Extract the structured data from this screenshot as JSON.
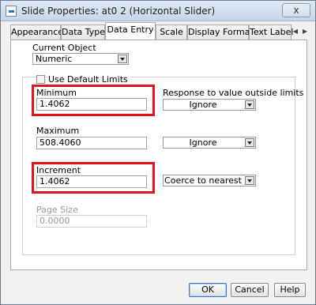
{
  "window": {
    "title": "Slide Properties: at0 2 (Horizontal Slider)",
    "close_label": "x"
  },
  "tabs": [
    {
      "label": "Appearance",
      "active": false
    },
    {
      "label": "Data Type",
      "active": false
    },
    {
      "label": "Data Entry",
      "active": true
    },
    {
      "label": "Scale",
      "active": false
    },
    {
      "label": "Display Format",
      "active": false
    },
    {
      "label": "Text Label",
      "active": false
    }
  ],
  "tab_scroll": {
    "left": "◀",
    "right": "▶"
  },
  "current_object": {
    "label": "Current Object",
    "value": "Numeric"
  },
  "use_default_limits": {
    "label": "Use Default Limits",
    "checked": false
  },
  "response_label": "Response to value outside limits",
  "minimum": {
    "label": "Minimum",
    "value": "1.4062",
    "response": "Ignore"
  },
  "maximum": {
    "label": "Maximum",
    "value": "508.4060",
    "response": "Ignore"
  },
  "increment": {
    "label": "Increment",
    "value": "1.4062",
    "response": "Coerce to nearest"
  },
  "page_size": {
    "label": "Page Size",
    "value": "0.0000"
  },
  "buttons": {
    "ok": "OK",
    "cancel": "Cancel",
    "help": "Help"
  },
  "colors": {
    "highlight": "#e0141e",
    "accent": "#3a7bd5"
  }
}
